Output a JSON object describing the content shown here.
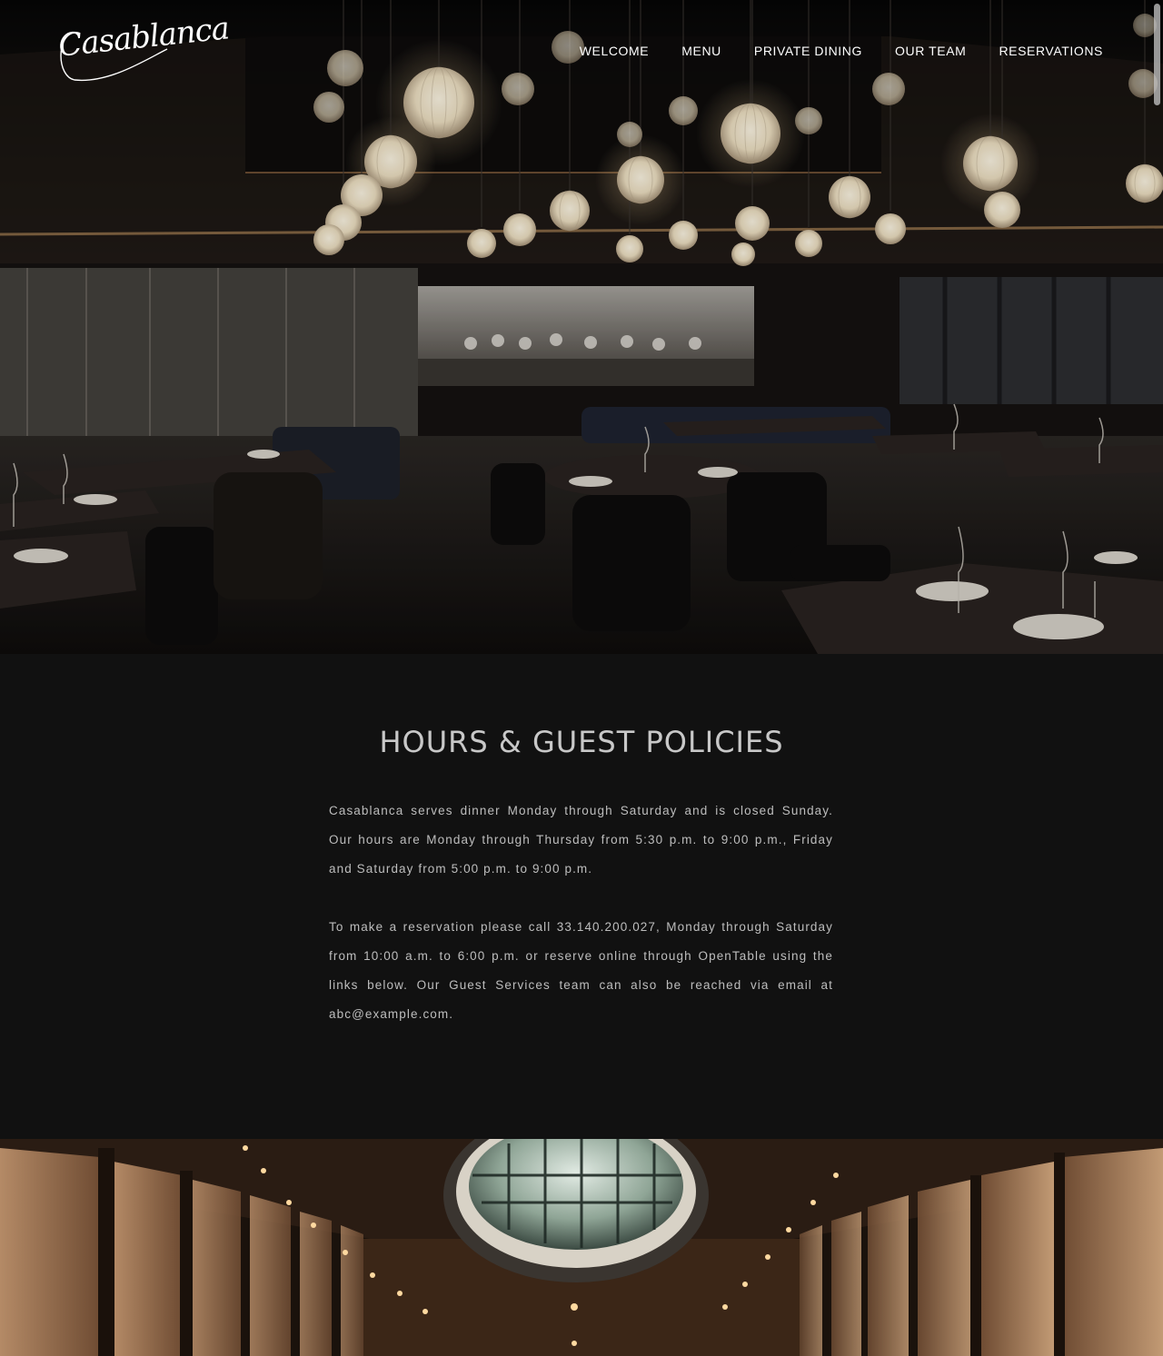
{
  "site": {
    "logo_text": "Casablanca"
  },
  "nav": {
    "items": [
      {
        "label": "WELCOME"
      },
      {
        "label": "MENU"
      },
      {
        "label": "PRIVATE DINING"
      },
      {
        "label": "OUR TEAM"
      },
      {
        "label": "RESERVATIONS"
      }
    ]
  },
  "hero": {
    "image": "restaurant-dining-room-photo"
  },
  "hours": {
    "title": "HOURS & GUEST POLICIES",
    "paragraph_1": "Casablanca serves dinner Monday through Saturday and is closed Sunday. Our hours are Monday through Thursday from 5:30 p.m. to 9:00 p.m., Friday and Saturday from 5:00 p.m. to 9:00 p.m.",
    "paragraph_2": "To make a reservation please call 33.140.200.027, Monday through Saturday from 10:00 a.m. to 6:00 p.m. or reserve online through OpenTable using the links below. Our Guest Services team can also be reached via email at abc@example.com."
  },
  "footer_image": {
    "image": "skylight-dining-hall-photo"
  },
  "colors": {
    "background": "#111111",
    "title": "#c8c8c8",
    "body_text": "#bdbdbd",
    "nav_text": "#ffffff"
  }
}
